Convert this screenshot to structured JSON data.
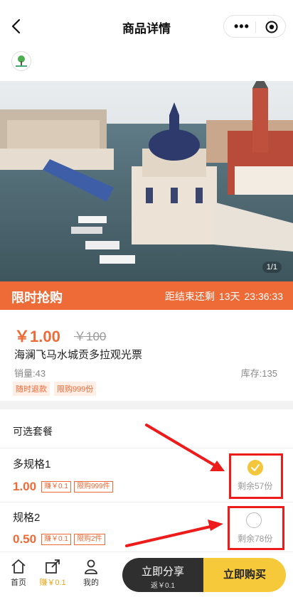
{
  "nav": {
    "title": "商品详情",
    "back_icon": "back-arrow-icon",
    "more_icon": "more-dots-icon",
    "close_icon": "target-icon"
  },
  "hero": {
    "pager": "1/1"
  },
  "flash_sale": {
    "label": "限时抢购",
    "countdown_prefix": "距结束还剩",
    "days": "13天",
    "time": "23:36:33",
    "color": "#ee6a37"
  },
  "product": {
    "price": "￥1.00",
    "original_price": "￥100",
    "name": "海澜飞马水城贡多拉观光票",
    "sales": "销量:43",
    "stock": "库存:135",
    "tags": [
      "随时退款",
      "限购999份"
    ]
  },
  "options": {
    "header": "可选套餐",
    "items": [
      {
        "title": "多规格1",
        "price": "1.00",
        "chips": [
          "赚￥0.1",
          "限购999件"
        ],
        "remain": "剩余57份",
        "selected": true
      },
      {
        "title": "规格2",
        "price": "0.50",
        "chips": [
          "赚￥0.1",
          "限购2件"
        ],
        "remain": "剩余78份",
        "selected": false
      }
    ]
  },
  "tabbar": {
    "tabs": [
      {
        "label": "首页",
        "icon": "home-icon"
      },
      {
        "label": "赚￥0.1",
        "icon": "share-icon"
      },
      {
        "label": "我的",
        "icon": "user-icon"
      }
    ],
    "share_label": "立即分享",
    "share_sub": "返￥0.1",
    "buy_label": "立即购买"
  },
  "colors": {
    "accent": "#ee6a37",
    "yellow": "#f6c93b",
    "dark": "#2f2f2f",
    "annotation_red": "#ee1b1b"
  }
}
